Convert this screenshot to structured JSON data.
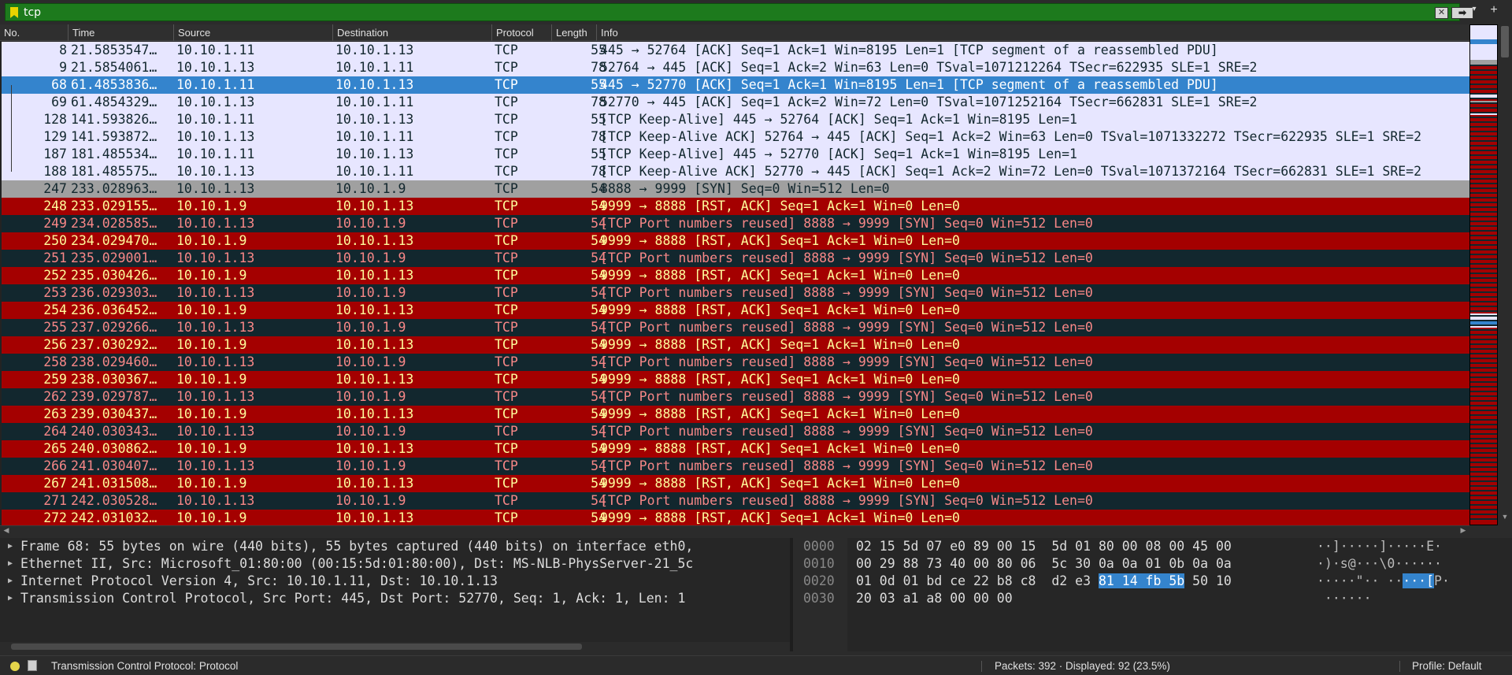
{
  "filter": {
    "text": "tcp",
    "clear_label": "✕",
    "apply_label": "➡",
    "dropdown_label": "▾",
    "add_label": "+"
  },
  "columns": [
    "No.",
    "Time",
    "Source",
    "Destination",
    "Protocol",
    "Length",
    "Info"
  ],
  "packets": [
    {
      "no": "8",
      "time": "21.5853547…",
      "src": "10.10.1.11",
      "dst": "10.10.1.13",
      "proto": "TCP",
      "len": "55",
      "info": "445 → 52764 [ACK] Seq=1 Ack=1 Win=8195 Len=1 [TCP segment of a reassembled PDU]",
      "color": "lav"
    },
    {
      "no": "9",
      "time": "21.5854061…",
      "src": "10.10.1.13",
      "dst": "10.10.1.11",
      "proto": "TCP",
      "len": "78",
      "info": "52764 → 445 [ACK] Seq=1 Ack=2 Win=63 Len=0 TSval=1071212264 TSecr=622935 SLE=1 SRE=2",
      "color": "lav"
    },
    {
      "no": "68",
      "time": "61.4853836…",
      "src": "10.10.1.11",
      "dst": "10.10.1.13",
      "proto": "TCP",
      "len": "55",
      "info": "445 → 52770 [ACK] Seq=1 Ack=1 Win=8195 Len=1 [TCP segment of a reassembled PDU]",
      "color": "sel"
    },
    {
      "no": "69",
      "time": "61.4854329…",
      "src": "10.10.1.13",
      "dst": "10.10.1.11",
      "proto": "TCP",
      "len": "78",
      "info": "52770 → 445 [ACK] Seq=1 Ack=2 Win=72 Len=0 TSval=1071252164 TSecr=662831 SLE=1 SRE=2",
      "color": "lav"
    },
    {
      "no": "128",
      "time": "141.593826…",
      "src": "10.10.1.11",
      "dst": "10.10.1.13",
      "proto": "TCP",
      "len": "55",
      "info": "[TCP Keep-Alive] 445 → 52764 [ACK] Seq=1 Ack=1 Win=8195 Len=1",
      "color": "lav"
    },
    {
      "no": "129",
      "time": "141.593872…",
      "src": "10.10.1.13",
      "dst": "10.10.1.11",
      "proto": "TCP",
      "len": "78",
      "info": "[TCP Keep-Alive ACK] 52764 → 445 [ACK] Seq=1 Ack=2 Win=63 Len=0 TSval=1071332272 TSecr=622935 SLE=1 SRE=2",
      "color": "lav"
    },
    {
      "no": "187",
      "time": "181.485534…",
      "src": "10.10.1.11",
      "dst": "10.10.1.13",
      "proto": "TCP",
      "len": "55",
      "info": "[TCP Keep-Alive] 445 → 52770 [ACK] Seq=1 Ack=1 Win=8195 Len=1",
      "color": "lav"
    },
    {
      "no": "188",
      "time": "181.485575…",
      "src": "10.10.1.13",
      "dst": "10.10.1.11",
      "proto": "TCP",
      "len": "78",
      "info": "[TCP Keep-Alive ACK] 52770 → 445 [ACK] Seq=1 Ack=2 Win=72 Len=0 TSval=1071372164 TSecr=662831 SLE=1 SRE=2",
      "color": "lav"
    },
    {
      "no": "247",
      "time": "233.028963…",
      "src": "10.10.1.13",
      "dst": "10.10.1.9",
      "proto": "TCP",
      "len": "54",
      "info": "8888 → 9999 [SYN] Seq=0 Win=512 Len=0",
      "color": "gray"
    },
    {
      "no": "248",
      "time": "233.029155…",
      "src": "10.10.1.9",
      "dst": "10.10.1.13",
      "proto": "TCP",
      "len": "54",
      "info": "9999 → 8888 [RST, ACK] Seq=1 Ack=1 Win=0 Len=0",
      "color": "red"
    },
    {
      "no": "249",
      "time": "234.028585…",
      "src": "10.10.1.13",
      "dst": "10.10.1.9",
      "proto": "TCP",
      "len": "54",
      "info": "[TCP Port numbers reused] 8888 → 9999 [SYN] Seq=0 Win=512 Len=0",
      "color": "dark"
    },
    {
      "no": "250",
      "time": "234.029470…",
      "src": "10.10.1.9",
      "dst": "10.10.1.13",
      "proto": "TCP",
      "len": "54",
      "info": "9999 → 8888 [RST, ACK] Seq=1 Ack=1 Win=0 Len=0",
      "color": "red"
    },
    {
      "no": "251",
      "time": "235.029001…",
      "src": "10.10.1.13",
      "dst": "10.10.1.9",
      "proto": "TCP",
      "len": "54",
      "info": "[TCP Port numbers reused] 8888 → 9999 [SYN] Seq=0 Win=512 Len=0",
      "color": "dark"
    },
    {
      "no": "252",
      "time": "235.030426…",
      "src": "10.10.1.9",
      "dst": "10.10.1.13",
      "proto": "TCP",
      "len": "54",
      "info": "9999 → 8888 [RST, ACK] Seq=1 Ack=1 Win=0 Len=0",
      "color": "red"
    },
    {
      "no": "253",
      "time": "236.029303…",
      "src": "10.10.1.13",
      "dst": "10.10.1.9",
      "proto": "TCP",
      "len": "54",
      "info": "[TCP Port numbers reused] 8888 → 9999 [SYN] Seq=0 Win=512 Len=0",
      "color": "dark"
    },
    {
      "no": "254",
      "time": "236.036452…",
      "src": "10.10.1.9",
      "dst": "10.10.1.13",
      "proto": "TCP",
      "len": "54",
      "info": "9999 → 8888 [RST, ACK] Seq=1 Ack=1 Win=0 Len=0",
      "color": "red"
    },
    {
      "no": "255",
      "time": "237.029266…",
      "src": "10.10.1.13",
      "dst": "10.10.1.9",
      "proto": "TCP",
      "len": "54",
      "info": "[TCP Port numbers reused] 8888 → 9999 [SYN] Seq=0 Win=512 Len=0",
      "color": "dark"
    },
    {
      "no": "256",
      "time": "237.030292…",
      "src": "10.10.1.9",
      "dst": "10.10.1.13",
      "proto": "TCP",
      "len": "54",
      "info": "9999 → 8888 [RST, ACK] Seq=1 Ack=1 Win=0 Len=0",
      "color": "red"
    },
    {
      "no": "258",
      "time": "238.029460…",
      "src": "10.10.1.13",
      "dst": "10.10.1.9",
      "proto": "TCP",
      "len": "54",
      "info": "[TCP Port numbers reused] 8888 → 9999 [SYN] Seq=0 Win=512 Len=0",
      "color": "dark"
    },
    {
      "no": "259",
      "time": "238.030367…",
      "src": "10.10.1.9",
      "dst": "10.10.1.13",
      "proto": "TCP",
      "len": "54",
      "info": "9999 → 8888 [RST, ACK] Seq=1 Ack=1 Win=0 Len=0",
      "color": "red"
    },
    {
      "no": "262",
      "time": "239.029787…",
      "src": "10.10.1.13",
      "dst": "10.10.1.9",
      "proto": "TCP",
      "len": "54",
      "info": "[TCP Port numbers reused] 8888 → 9999 [SYN] Seq=0 Win=512 Len=0",
      "color": "dark"
    },
    {
      "no": "263",
      "time": "239.030437…",
      "src": "10.10.1.9",
      "dst": "10.10.1.13",
      "proto": "TCP",
      "len": "54",
      "info": "9999 → 8888 [RST, ACK] Seq=1 Ack=1 Win=0 Len=0",
      "color": "red"
    },
    {
      "no": "264",
      "time": "240.030343…",
      "src": "10.10.1.13",
      "dst": "10.10.1.9",
      "proto": "TCP",
      "len": "54",
      "info": "[TCP Port numbers reused] 8888 → 9999 [SYN] Seq=0 Win=512 Len=0",
      "color": "dark"
    },
    {
      "no": "265",
      "time": "240.030862…",
      "src": "10.10.1.9",
      "dst": "10.10.1.13",
      "proto": "TCP",
      "len": "54",
      "info": "9999 → 8888 [RST, ACK] Seq=1 Ack=1 Win=0 Len=0",
      "color": "red"
    },
    {
      "no": "266",
      "time": "241.030407…",
      "src": "10.10.1.13",
      "dst": "10.10.1.9",
      "proto": "TCP",
      "len": "54",
      "info": "[TCP Port numbers reused] 8888 → 9999 [SYN] Seq=0 Win=512 Len=0",
      "color": "dark"
    },
    {
      "no": "267",
      "time": "241.031508…",
      "src": "10.10.1.9",
      "dst": "10.10.1.13",
      "proto": "TCP",
      "len": "54",
      "info": "9999 → 8888 [RST, ACK] Seq=1 Ack=1 Win=0 Len=0",
      "color": "red"
    },
    {
      "no": "271",
      "time": "242.030528…",
      "src": "10.10.1.13",
      "dst": "10.10.1.9",
      "proto": "TCP",
      "len": "54",
      "info": "[TCP Port numbers reused] 8888 → 9999 [SYN] Seq=0 Win=512 Len=0",
      "color": "dark"
    },
    {
      "no": "272",
      "time": "242.031032…",
      "src": "10.10.1.9",
      "dst": "10.10.1.13",
      "proto": "TCP",
      "len": "54",
      "info": "9999 → 8888 [RST, ACK] Seq=1 Ack=1 Win=0 Len=0",
      "color": "red"
    }
  ],
  "details": [
    "Frame 68: 55 bytes on wire (440 bits), 55 bytes captured (440 bits) on interface eth0,",
    "Ethernet II, Src: Microsoft_01:80:00 (00:15:5d:01:80:00), Dst: MS-NLB-PhysServer-21_5c",
    "Internet Protocol Version 4, Src: 10.10.1.11, Dst: 10.10.1.13",
    "Transmission Control Protocol, Src Port: 445, Dst Port: 52770, Seq: 1, Ack: 1, Len: 1"
  ],
  "bytes": [
    {
      "offset": "0000",
      "hex_pre": "02 15 5d 07 e0 89 00 15  5d 01 80 00 08 00 45 00",
      "hex_hl": "",
      "hex_post": "",
      "ascii_pre": "··]·····]·····E·",
      "ascii_hl": "",
      "ascii_post": ""
    },
    {
      "offset": "0010",
      "hex_pre": "00 29 88 73 40 00 80 06  5c 30 0a 0a 01 0b 0a 0a",
      "hex_hl": "",
      "hex_post": "",
      "ascii_pre": "·)·s@···\\0······",
      "ascii_hl": "",
      "ascii_post": ""
    },
    {
      "offset": "0020",
      "hex_pre": "01 0d 01 bd ce 22 b8 c8  d2 e3 ",
      "hex_hl": "81 14 fb 5b",
      "hex_post": " 50 10",
      "ascii_pre": "·····\"·· ··",
      "ascii_hl": "···[",
      "ascii_post": "P·"
    },
    {
      "offset": "0030",
      "hex_pre": "20 03 a1 a8 00 00 00",
      "hex_hl": "",
      "hex_post": "",
      "ascii_pre": " ······",
      "ascii_hl": "",
      "ascii_post": ""
    }
  ],
  "status": {
    "field_label": "Transmission Control Protocol: Protocol",
    "packets_label": "Packets: 392 · Displayed: 92 (23.5%)",
    "profile_label": "Profile: Default"
  },
  "colors": {
    "filter_valid": "#1d7a1d",
    "selected": "#3484cd",
    "tcp_rst": "#a40000",
    "bad_tcp": "#12272e",
    "tcp": "#e7e6ff"
  }
}
